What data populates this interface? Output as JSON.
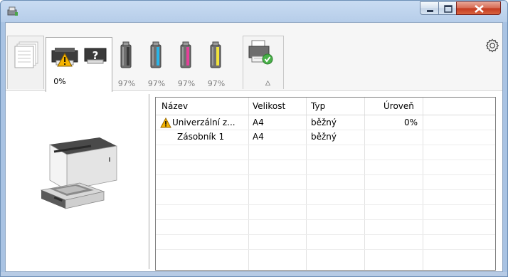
{
  "window": {
    "title": ""
  },
  "toolbar": {
    "main_tab_percent": "0%",
    "toners": [
      {
        "color": "black",
        "hex": "#3a3a3a",
        "label": "97%"
      },
      {
        "color": "cyan",
        "hex": "#29b5e8",
        "label": "97%"
      },
      {
        "color": "magenta",
        "hex": "#e5409a",
        "label": "97%"
      },
      {
        "color": "yellow",
        "hex": "#f2e33b",
        "label": "97%"
      }
    ],
    "collapse_glyph": "△",
    "settings_icon": "gear-icon"
  },
  "trays": {
    "columns": [
      "Název",
      "Velikost",
      "Typ",
      "Úroveň"
    ],
    "rows": [
      {
        "name": "Univerzální z...",
        "size": "A4",
        "type": "běžný",
        "level": "0%",
        "warning": true
      },
      {
        "name": "Zásobník 1",
        "size": "A4",
        "type": "běžný",
        "level": "",
        "warning": false
      }
    ]
  },
  "colors": {
    "title_bar": "#b6cde9",
    "close_button": "#c3391e",
    "warning": "#f5b400"
  }
}
